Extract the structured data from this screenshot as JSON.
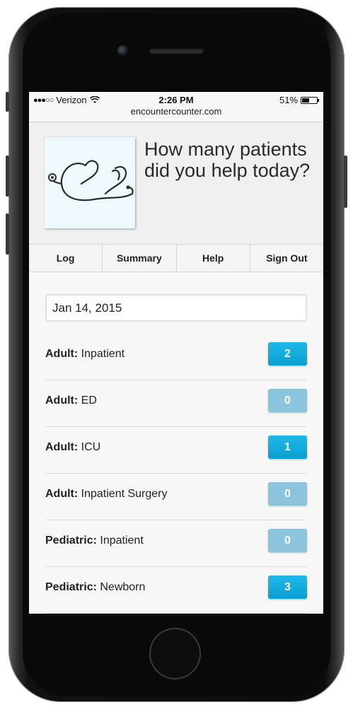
{
  "status_bar": {
    "carrier": "Verizon",
    "time": "2:26 PM",
    "battery": "51%",
    "battery_level": 0.51
  },
  "url": "encountercounter.com",
  "header": {
    "tagline": "How many patients did you help today?"
  },
  "nav": {
    "items": [
      {
        "label": "Log"
      },
      {
        "label": "Summary"
      },
      {
        "label": "Help"
      },
      {
        "label": "Sign Out"
      }
    ]
  },
  "date_input": {
    "value": "Jan 14, 2015"
  },
  "encounters": [
    {
      "category": "Adult:",
      "type": "Inpatient",
      "count": "2",
      "active": true
    },
    {
      "category": "Adult:",
      "type": "ED",
      "count": "0",
      "active": false
    },
    {
      "category": "Adult:",
      "type": "ICU",
      "count": "1",
      "active": true
    },
    {
      "category": "Adult:",
      "type": "Inpatient Surgery",
      "count": "0",
      "active": false
    },
    {
      "category": "Pediatric:",
      "type": "Inpatient",
      "count": "0",
      "active": false
    },
    {
      "category": "Pediatric:",
      "type": "Newborn",
      "count": "3",
      "active": true
    }
  ],
  "colors": {
    "accent": "#0aa5d8",
    "inactive": "#8bc4dc"
  }
}
